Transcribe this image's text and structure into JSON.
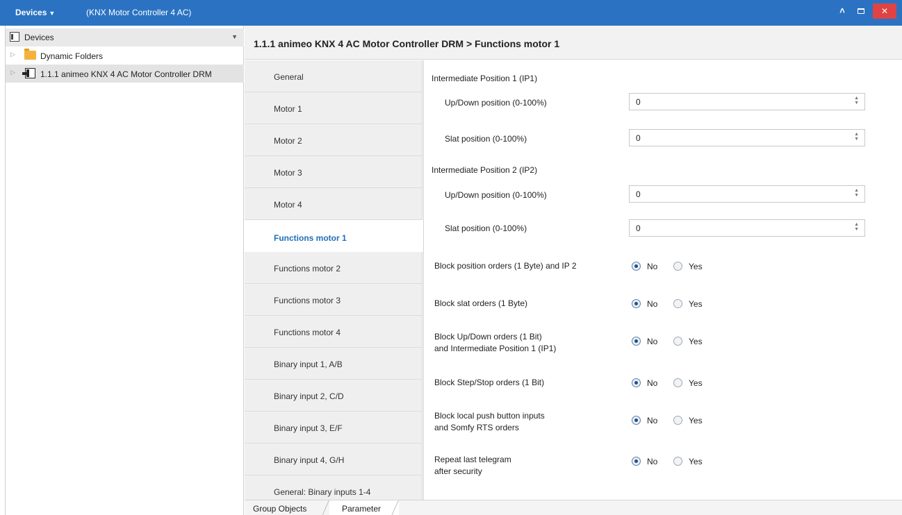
{
  "titlebar": {
    "menu_label": "Devices",
    "window_title": "(KNX Motor Controller 4 AC)",
    "close_glyph": "✕",
    "collapse_glyph": "^"
  },
  "left_panel": {
    "header_title": "Devices",
    "tree": [
      {
        "label": "Dynamic Folders",
        "icon": "folder-icon"
      },
      {
        "label": "1.1.1 animeo KNX 4 AC Motor Controller DRM",
        "icon": "device-icon",
        "selected": true
      }
    ]
  },
  "breadcrumb": "1.1.1 animeo KNX 4 AC Motor Controller DRM > Functions motor 1",
  "tabs": [
    {
      "label": "General"
    },
    {
      "label": "Motor 1"
    },
    {
      "label": "Motor 2"
    },
    {
      "label": "Motor 3"
    },
    {
      "label": "Motor 4"
    },
    {
      "label": "Functions motor 1",
      "active": true
    },
    {
      "label": "Functions motor 2"
    },
    {
      "label": "Functions motor 3"
    },
    {
      "label": "Functions motor 4"
    },
    {
      "label": "Binary input 1, A/B"
    },
    {
      "label": "Binary input 2, C/D"
    },
    {
      "label": "Binary input 3, E/F"
    },
    {
      "label": "Binary input 4, G/H"
    },
    {
      "label": "General: Binary inputs 1-4"
    }
  ],
  "params": {
    "ip1_heading": "Intermediate Position 1 (IP1)",
    "ip1_updown_label": "Up/Down position (0-100%)",
    "ip1_updown_value": "0",
    "ip1_slat_label": "Slat position (0-100%)",
    "ip1_slat_value": "0",
    "ip2_heading": "Intermediate Position 2 (IP2)",
    "ip2_updown_label": "Up/Down position (0-100%)",
    "ip2_updown_value": "0",
    "ip2_slat_label": "Slat position (0-100%)",
    "ip2_slat_value": "0",
    "radio_no": "No",
    "radio_yes": "Yes",
    "blocks": [
      {
        "line1": "Block position orders (1 Byte) and IP 2",
        "line2": "",
        "selected": "No"
      },
      {
        "line1": "Block slat orders (1 Byte)",
        "line2": "",
        "selected": "No"
      },
      {
        "line1": "Block Up/Down orders (1 Bit)",
        "line2": "and Intermediate Position 1 (IP1)",
        "selected": "No"
      },
      {
        "line1": "Block Step/Stop orders (1 Bit)",
        "line2": "",
        "selected": "No"
      },
      {
        "line1": "Block local push button inputs",
        "line2": "and Somfy RTS orders",
        "selected": "No"
      },
      {
        "line1": "Repeat last telegram",
        "line2": "after security",
        "selected": "No"
      }
    ]
  },
  "bottom_tabs": {
    "group_objects": "Group Objects",
    "parameter": "Parameter"
  }
}
